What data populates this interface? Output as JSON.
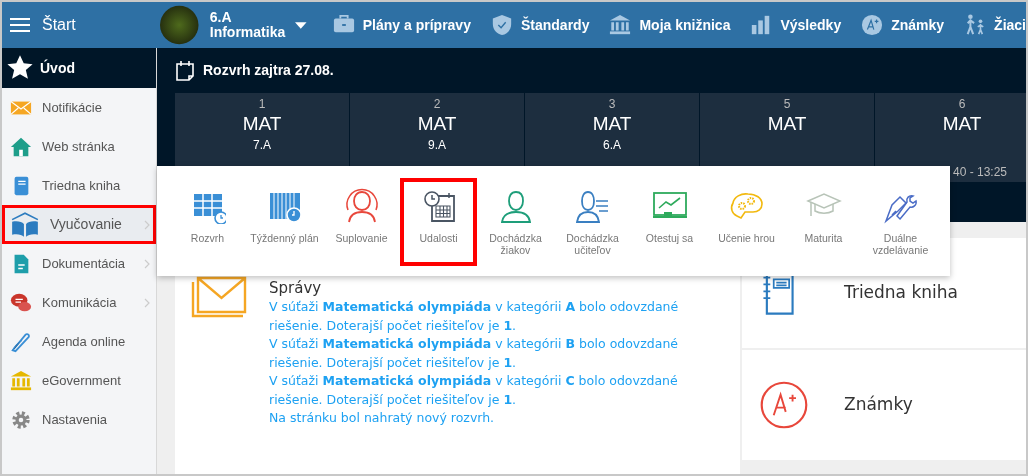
{
  "topbar": {
    "menu_label": "Štart",
    "class_name": "6.A",
    "subject": "Informatika",
    "nav": [
      {
        "label": "Plány a prípravy",
        "kind": "briefcase"
      },
      {
        "label": "Štandardy",
        "kind": "shield"
      },
      {
        "label": "Moja knižnica",
        "kind": "bank"
      },
      {
        "label": "Výsledky",
        "kind": "bars"
      },
      {
        "label": "Známky",
        "kind": "grade"
      },
      {
        "label": "Žiaci",
        "kind": "walkers"
      }
    ]
  },
  "sidebar": {
    "home": "Úvod",
    "items": [
      {
        "label": "Notifikácie",
        "kind": "envelope",
        "selected": false,
        "submenu": false
      },
      {
        "label": "Web stránka",
        "kind": "house",
        "selected": false,
        "submenu": false
      },
      {
        "label": "Triedna kniha",
        "kind": "notebook",
        "selected": false,
        "submenu": false
      },
      {
        "label": "Vyučovanie",
        "kind": "book",
        "selected": true,
        "submenu": true
      },
      {
        "label": "Dokumentácia",
        "kind": "document",
        "selected": false,
        "submenu": true
      },
      {
        "label": "Komunikácia",
        "kind": "chat",
        "selected": false,
        "submenu": true
      },
      {
        "label": "Agenda online",
        "kind": "pen",
        "selected": false,
        "submenu": false
      },
      {
        "label": "eGovernment",
        "kind": "bank",
        "selected": false,
        "submenu": false
      },
      {
        "label": "Nastavenia",
        "kind": "gear",
        "selected": false,
        "submenu": false
      }
    ]
  },
  "schedule": {
    "title": "Rozvrh zajtra 27.08.",
    "lessons": [
      {
        "number": "1",
        "subject": "MAT",
        "class": "7.A"
      },
      {
        "number": "2",
        "subject": "MAT",
        "class": "9.A"
      },
      {
        "number": "3",
        "subject": "MAT",
        "class": "6.A"
      },
      {
        "number": "5",
        "subject": "MAT"
      },
      {
        "number": "6",
        "subject": "MAT",
        "time": "40 - 13:25"
      }
    ]
  },
  "popup": {
    "items": [
      {
        "label": "Rozvrh",
        "kind": "table",
        "highlighted": false
      },
      {
        "label": "Týždenný plán",
        "kind": "week",
        "highlighted": false
      },
      {
        "label": "Suplovanie",
        "kind": "substitute",
        "highlighted": false
      },
      {
        "label": "Udalosti",
        "kind": "events",
        "highlighted": true
      },
      {
        "label": "Dochádzka žiakov",
        "kind": "person",
        "highlighted": false
      },
      {
        "label": "Dochádzka učiteľov",
        "kind": "person-list",
        "highlighted": false
      },
      {
        "label": "Otestuj sa",
        "kind": "board",
        "highlighted": false
      },
      {
        "label": "Učenie hrou",
        "kind": "brain",
        "highlighted": false
      },
      {
        "label": "Maturita",
        "kind": "cap",
        "highlighted": false
      },
      {
        "label": "Duálne vzdelávanie",
        "kind": "tools",
        "highlighted": false
      }
    ]
  },
  "messages": {
    "title": "Správy",
    "items": [
      "V súťaži **Matematická olympiáda** v kategórii **A** bolo odovzdané riešenie. Doterajší počet riešiteľov je **1**.",
      "V súťaži **Matematická olympiáda** v kategórii **B** bolo odovzdané riešenie. Doterajší počet riešiteľov je **1**.",
      "V súťaži **Matematická olympiáda** v kategórii **C** bolo odovzdané riešenie. Doterajší počet riešiteľov je **1**.",
      "Na stránku bol nahratý nový rozvrh."
    ]
  },
  "tiles": [
    {
      "label": "Triedna kniha",
      "kind": "notebook"
    },
    {
      "label": "Známky",
      "kind": "grade"
    }
  ]
}
